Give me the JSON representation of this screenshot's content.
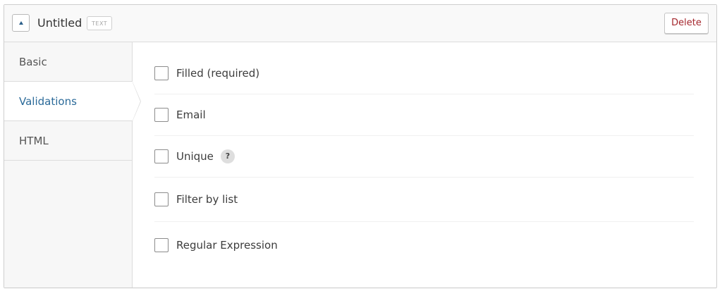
{
  "header": {
    "title": "Untitled",
    "type_badge": "TEXT",
    "delete_label": "Delete"
  },
  "sidebar": {
    "tabs": [
      {
        "label": "Basic",
        "active": false
      },
      {
        "label": "Validations",
        "active": true
      },
      {
        "label": "HTML",
        "active": false
      }
    ]
  },
  "validations": {
    "options": [
      {
        "label": "Filled (required)",
        "checked": false
      },
      {
        "label": "Email",
        "checked": false
      },
      {
        "label": "Unique",
        "checked": false,
        "help": "?"
      },
      {
        "label": "Filter by list",
        "checked": false
      },
      {
        "label": "Regular Expression",
        "checked": false
      }
    ]
  },
  "colors": {
    "accent": "#2b6a99",
    "delete": "#a4262c",
    "border": "#cfcfcf",
    "sidebar_bg": "#f7f7f7"
  },
  "icons": {
    "collapse": "triangle-up-icon",
    "help": "question-icon"
  }
}
